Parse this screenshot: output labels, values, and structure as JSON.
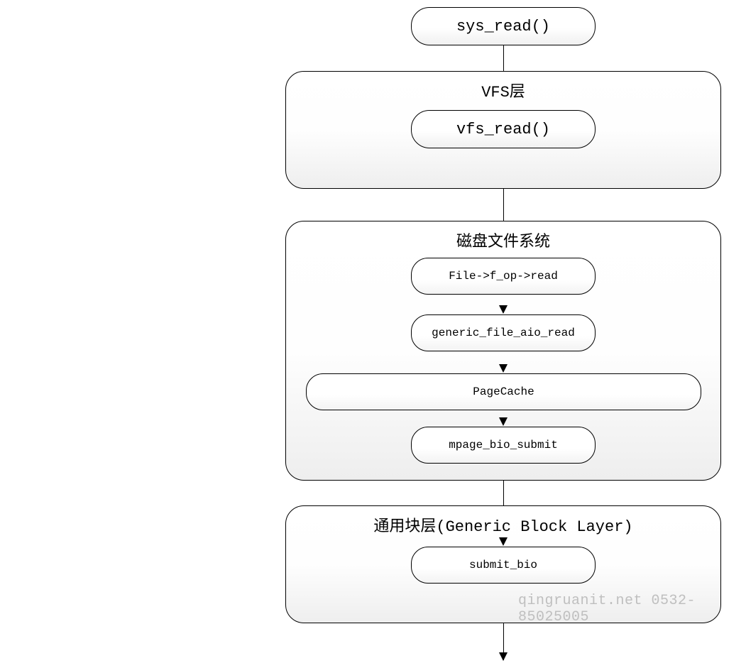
{
  "nodes": {
    "sys_read": "sys_read()",
    "vfs_read": "vfs_read()",
    "fop_read": "File->f_op->read",
    "generic_aio": "generic_file_aio_read",
    "pagecache": "PageCache",
    "mpage_bio": "mpage_bio_submit",
    "submit_bio": "submit_bio"
  },
  "layers": {
    "vfs": "VFS层",
    "diskfs": "磁盘文件系统",
    "block": "通用块层(Generic Block Layer)"
  },
  "watermark": "qingruanit.net 0532-85025005"
}
